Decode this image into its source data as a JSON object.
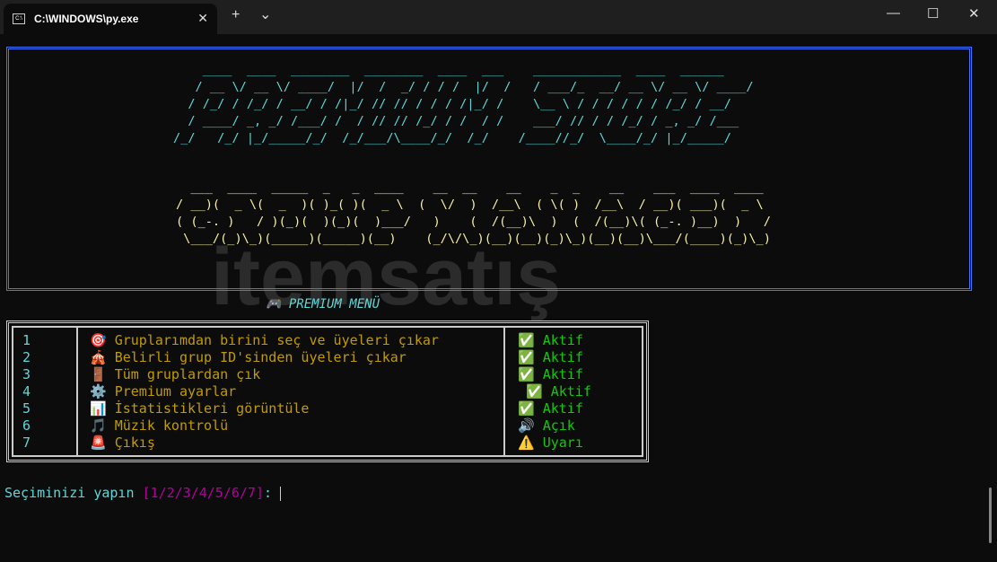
{
  "window": {
    "tab_title": "C:\\WINDOWS\\py.exe",
    "new_tab": "+",
    "dropdown": "⌄",
    "close_tab": "✕",
    "minimize": "—",
    "maximize": "☐",
    "close": "✕"
  },
  "banner": {
    "line1": [
      "    ____  ____  ________  ________  ____  ___    ____________  ____  ______",
      "   / __ \\/ __ \\/ ____/  |/  /  _/ / / /  |/  /   / ___/_  __/ __ \\/ __ \\/ ____/",
      "  / /_/ / /_/ / __/ / /|_/ // // / / / /|_/ /    \\__ \\ / / / / / / /_/ / __/",
      "  / ____/ _, _/ /___/ /  / // // /_/ / /  / /    ___/ // / / /_/ / _, _/ /___",
      "/_/   /_/ |_/_____/_/  /_/___/\\____/_/  /_/    /____//_/  \\____/_/ |_/_____/"
    ],
    "line2": [
      "  ___  ____  _____  _   _  ____    __  __    __    _  _    __    ___  ____  ____",
      "/ __)(  _ \\(  _  )( )_( )(  _ \\  (  \\/  )  /__\\  ( \\( )  /__\\  / __)( ___)(  _ \\",
      "( (_-. )   / )(_)(  )(_)(  )___/   )    (  /(__)\\  )  (  /(__)\\( (_-. )__)  )   /",
      " \\___/(_)\\_)(_____)(_____)(__)    (_/\\/\\_)(__)(__)(_)\\_)(__)(__)\\___/(____)(_)\\_)"
    ]
  },
  "menu_title": "🎮 PREMIUM MENÜ",
  "menu": [
    {
      "num": "1",
      "icon": "🎯",
      "label": "Gruplarımdan birini seç ve üyeleri çıkar",
      "status_icon": "✅",
      "status": "Aktif"
    },
    {
      "num": "2",
      "icon": "🎪",
      "label": "Belirli grup ID'sinden üyeleri çıkar",
      "status_icon": "✅",
      "status": "Aktif"
    },
    {
      "num": "3",
      "icon": "🚪",
      "label": "Tüm gruplardan çık",
      "status_icon": "✅",
      "status": "Aktif"
    },
    {
      "num": "4",
      "icon": "⚙️",
      "label": "Premium ayarlar",
      "status_icon": "✅",
      "status": "Aktif"
    },
    {
      "num": "5",
      "icon": "📊",
      "label": "İstatistikleri görüntüle",
      "status_icon": "✅",
      "status": "Aktif"
    },
    {
      "num": "6",
      "icon": "🎵",
      "label": "Müzik kontrolü",
      "status_icon": "🔊",
      "status": "Açık"
    },
    {
      "num": "7",
      "icon": "🚨",
      "label": "Çıkış",
      "status_icon": "⚠️",
      "status": "Uyarı"
    }
  ],
  "prompt": {
    "text": "Seçiminizi yapın ",
    "options": "[1/2/3/4/5/6/7]",
    "suffix": ": "
  },
  "watermark": "itemsatış"
}
